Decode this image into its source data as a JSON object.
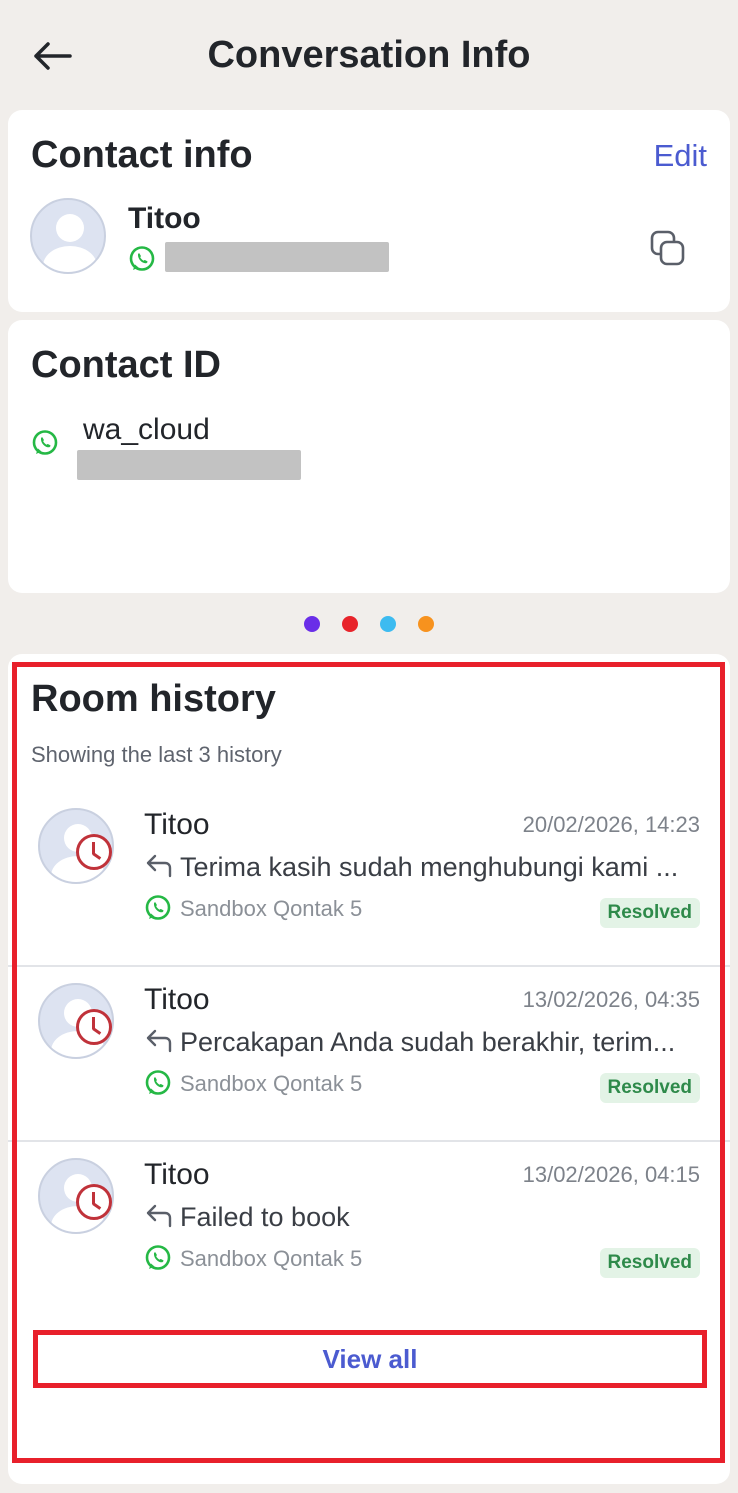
{
  "header": {
    "title": "Conversation Info",
    "back_icon": "arrow-left-icon"
  },
  "contact_info": {
    "title": "Contact info",
    "edit_label": "Edit",
    "name": "Titoo",
    "channel_icon": "whatsapp-icon",
    "copy_icon": "copy-icon"
  },
  "contact_id": {
    "title": "Contact ID",
    "channel_icon": "whatsapp-icon",
    "label": "wa_cloud"
  },
  "pager": {
    "dot_colors": [
      "#6a2ee8",
      "#e8232a",
      "#3dbbf0",
      "#f7921e"
    ]
  },
  "room_history": {
    "title": "Room history",
    "subtitle": "Showing the last 3 history",
    "items": [
      {
        "name": "Titoo",
        "time": "20/02/2026, 14:23",
        "message": "Terima kasih sudah menghubungi kami ...",
        "channel": "Sandbox Qontak 5",
        "status": "Resolved"
      },
      {
        "name": "Titoo",
        "time": "13/02/2026, 04:35",
        "message": "Percakapan Anda sudah berakhir, terim...",
        "channel": "Sandbox Qontak 5",
        "status": "Resolved"
      },
      {
        "name": "Titoo",
        "time": "13/02/2026, 04:15",
        "message": "Failed to book",
        "channel": "Sandbox Qontak 5",
        "status": "Resolved"
      }
    ],
    "view_all_label": "View all"
  },
  "colors": {
    "accent": "#4b5bd0",
    "highlight": "#e8202b",
    "whatsapp": "#25b845",
    "resolved": "#2e8a4a"
  }
}
